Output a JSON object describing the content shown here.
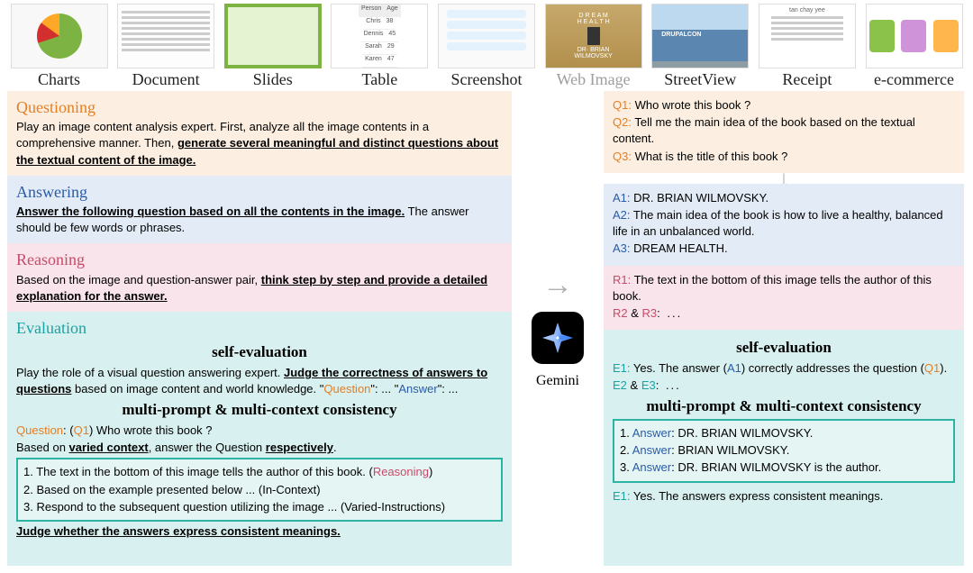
{
  "thumbs": {
    "charts": "Charts",
    "document": "Document",
    "slides": "Slides",
    "table": "Table",
    "screenshot": "Screenshot",
    "webimage": "Web Image",
    "streetview": "StreetView",
    "receipt": "Receipt",
    "ecommerce": "e-commerce",
    "table_rows": [
      [
        "Person",
        "Age"
      ],
      [
        "Chris",
        "38"
      ],
      [
        "Dennis",
        "45"
      ],
      [
        "Sarah",
        "29"
      ],
      [
        "Karen",
        "47"
      ]
    ],
    "web_lines": [
      "D R E A M",
      "H E A L T H",
      "DR· BRIAN",
      "WILMOVSKY"
    ],
    "receipt_top": "tan chay yee"
  },
  "left": {
    "q_title": "Questioning",
    "q_p1a": "Play an image content analysis expert. First, analyze all the image contents in a comprehensive manner. Then, ",
    "q_p1b": "generate several meaningful and distinct questions about the textual content of the image.",
    "a_title": "Answering",
    "a_p1a": "Answer the following question based on all the contents in the image.",
    "a_p1b": " The answer should be few words or phrases.",
    "r_title": "Reasoning",
    "r_p1a": "Based on the image and question-answer pair, ",
    "r_p1b": "think step by step and provide a detailed explanation for the answer.",
    "e_title": "Evaluation",
    "e_self": "self-evaluation",
    "e_p1a": "Play the role of a visual question answering expert. ",
    "e_p1b": "Judge the correctness of answers to questions",
    "e_p1c": " based on image content and world knowledge.  \"",
    "e_p1d": "Question",
    "e_p1e": "\": ... \"",
    "e_p1f": "Answer",
    "e_p1g": "\": ...",
    "e_mp": "multi-prompt & multi-context consistency",
    "e_qlabel": "Question",
    "e_q1tag": "Q1",
    "e_q1txt": ") Who wrote this book ?",
    "e_line2a": "Based on ",
    "e_line2b": "varied context",
    "e_line2c": ", answer the Question ",
    "e_line2d": "respectively",
    "e_box1a": "1. The text in the bottom of this image tells the author of this book.  (",
    "e_box1b": "Reasoning",
    "e_box1c": ")",
    "e_box2": "2. Based on the example presented below ... (In-Context)",
    "e_box3": "3. Respond to the subsequent question utilizing the image ... (Varied-Instructions)",
    "e_judge": "Judge whether the answers express consistent meanings."
  },
  "center": {
    "gemini": "Gemini"
  },
  "right": {
    "q1l": "Q1:",
    "q1": " Who wrote this book ?",
    "q2l": "Q2:",
    "q2": " Tell me the main idea of the book based on the textual content.",
    "q3l": "Q3:",
    "q3": " What is the title of this book ?",
    "a1l": "A1:",
    "a1": " DR. BRIAN WILMOVSKY.",
    "a2l": "A2:",
    "a2": " The main idea of the book is how to live a healthy, balanced life in an unbalanced world.",
    "a3l": "A3:",
    "a3": " DREAM HEALTH.",
    "r1l": "R1:",
    "r1": " The text in the bottom of this image tells the author of this book.",
    "r2l": "R2",
    "r3l": "R3",
    "r23rest": ":            ...",
    "amp": " & ",
    "self": "self-evaluation",
    "e1l": "E1:",
    "e1a": " Yes. The answer (",
    "e1b": "A1",
    "e1c": ") correctly addresses the question (",
    "e1d": "Q1",
    "e1e": ").",
    "e23a": "E2",
    "e23b": "E3",
    "e23rest": ":            ...",
    "mp": "multi-prompt & multi-context consistency",
    "ans_label": "Answer",
    "ans1": ": DR. BRIAN WILMOVSKY.",
    "ans2": ": BRIAN WILMOVSKY.",
    "ans3": ": DR. BRIAN WILMOVSKY is the author.",
    "n1": "1. ",
    "n2": "2. ",
    "n3": "3. ",
    "efl": "E1:",
    "ef": " Yes. The answers express consistent meanings."
  }
}
